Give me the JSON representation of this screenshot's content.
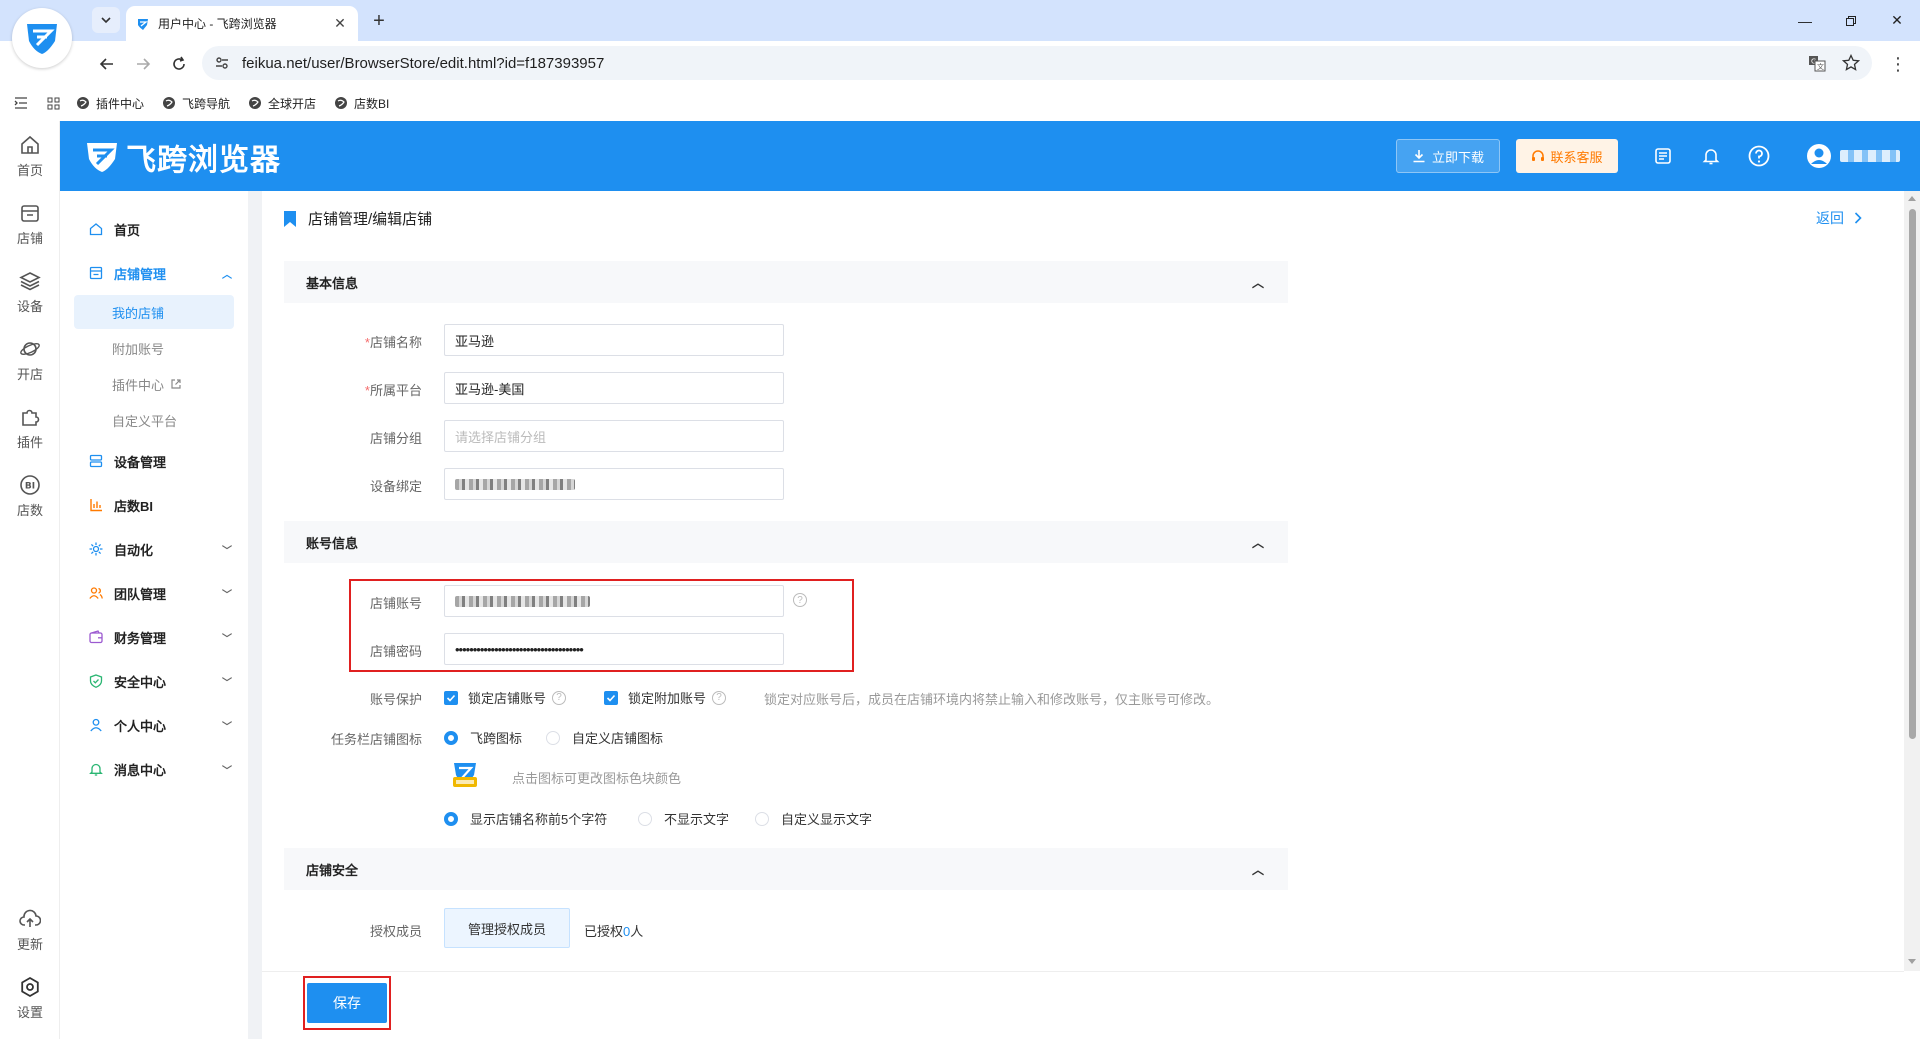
{
  "browser": {
    "tab_title": "用户中心 - 飞跨浏览器",
    "url": "feikua.net/user/BrowserStore/edit.html?id=f187393957",
    "bookmarks": [
      "插件中心",
      "飞跨导航",
      "全球开店",
      "店数BI"
    ]
  },
  "rail": {
    "items": [
      "首页",
      "店铺",
      "设备",
      "开店",
      "插件"
    ],
    "bi_label": "店数",
    "bi_badge": "BI",
    "update": "更新",
    "settings": "设置"
  },
  "header": {
    "brand": "飞跨浏览器",
    "download_label": "立即下载",
    "service_label": "联系客服"
  },
  "sidebar": {
    "home": "首页",
    "store_mgmt": "店铺管理",
    "sub_items": [
      "我的店铺",
      "附加账号",
      "插件中心",
      "自定义平台"
    ],
    "device_mgmt": "设备管理",
    "store_bi": "店数BI",
    "automation": "自动化",
    "team_mgmt": "团队管理",
    "finance_mgmt": "财务管理",
    "security_center": "安全中心",
    "personal_center": "个人中心",
    "message_center": "消息中心"
  },
  "page": {
    "title": "店铺管理/编辑店铺",
    "back": "返回"
  },
  "sections": {
    "basic": "基本信息",
    "account": "账号信息",
    "security": "店铺安全"
  },
  "form": {
    "required_mark": "*",
    "store_name_label": "店铺名称",
    "store_name_value": "亚马逊",
    "platform_label": "所属平台",
    "platform_value": "亚马逊-美国",
    "group_label": "店铺分组",
    "group_placeholder": "请选择店铺分组",
    "device_label": "设备绑定",
    "account_label": "店铺账号",
    "password_label": "店铺密码",
    "password_value": "••••••••••••••••••••••••••••••••••••",
    "protect_label": "账号保护",
    "lock_store_account": "锁定店铺账号",
    "lock_extra_account": "锁定附加账号",
    "protect_hint": "锁定对应账号后，成员在店铺环境内将禁止输入和修改账号，仅主账号可修改。",
    "taskbar_icon_label": "任务栏店铺图标",
    "feikua_icon": "飞跨图标",
    "custom_icon": "自定义店铺图标",
    "icon_hint": "点击图标可更改图标色块颜色",
    "show_first5": "显示店铺名称前5个字符",
    "no_text": "不显示文字",
    "custom_text": "自定义显示文字",
    "auth_label": "授权成员",
    "manage_auth_btn": "管理授权成员",
    "authorized_prefix": "已授权",
    "authorized_count": "0",
    "authorized_suffix": "人"
  },
  "footer": {
    "save": "保存"
  },
  "colors": {
    "primary": "#1e8ff0",
    "service_orange": "#ff7a00",
    "highlight_red": "#e02020",
    "required_red": "#f56c6c"
  }
}
